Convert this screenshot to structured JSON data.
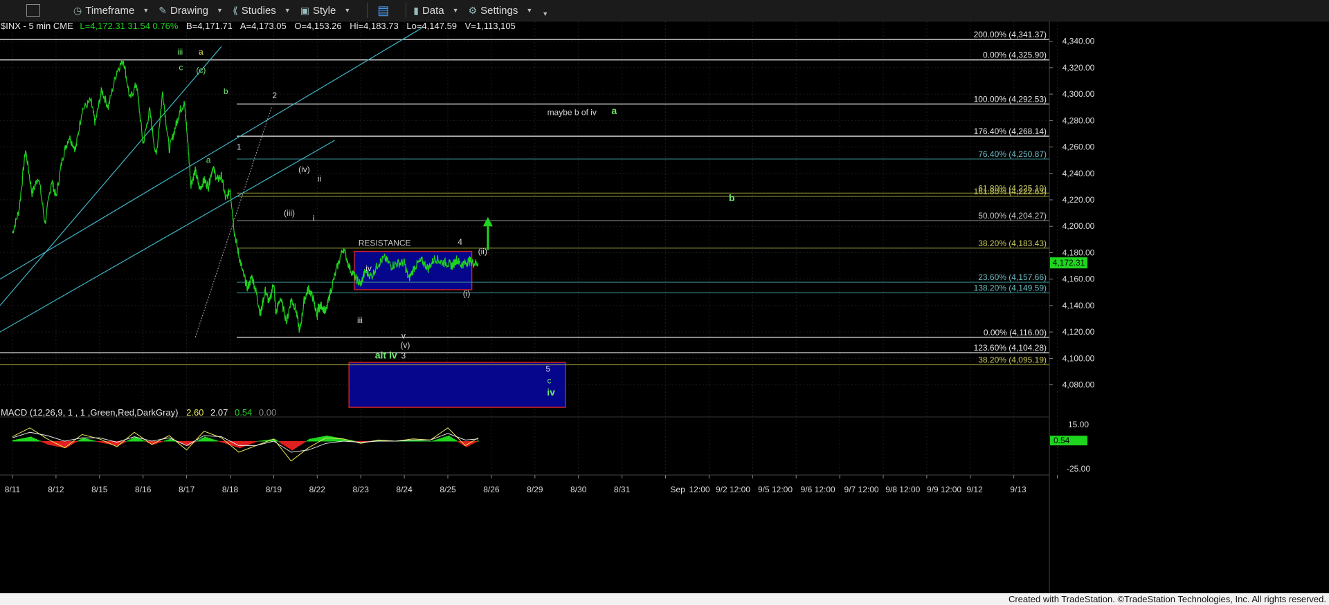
{
  "toolbar": {
    "timeframe_label": "Timeframe",
    "drawing_label": "Drawing",
    "studies_label": "Studies",
    "style_label": "Style",
    "data_label": "Data",
    "settings_label": "Settings"
  },
  "symbol_bar": {
    "symbol": "$INX - 5 min  CME",
    "last": "L=4,172.31  31.54  0.76%",
    "bid": "B=4,171.71",
    "ask": "A=4,173.05",
    "open": "O=4,153.26",
    "high": "Hi=4,183.73",
    "low": "Lo=4,147.59",
    "volume": "V=1,113,105"
  },
  "indicator": {
    "label": "MACD (12,26,9, 1 , 1 ,Green,Red,DarkGray)",
    "macd": "2.60",
    "signal": "2.07",
    "hist": "0.54",
    "zero": "0.00",
    "axis_labels": [
      "15.00",
      "0.54",
      "-25.00"
    ]
  },
  "footer_text": "Created with TradeStation. ©TradeStation Technologies, Inc. All rights reserved.",
  "colors": {
    "price": "#1fd41f",
    "channel": "#3fb6c8",
    "fib_white": "#dcdcdc",
    "fib_gray": "#9aa0a6",
    "fib_teal": "#3d8f94",
    "fib_olive": "#9a9a3a",
    "box_fill": "#06068c",
    "box_border": "#cc2222",
    "label_green": "#6fe86f",
    "label_yellow": "#e8e85a"
  },
  "chart_data": {
    "type": "line",
    "title": "",
    "ylim": [
      4062,
      4355
    ],
    "y_ticks": [
      4080,
      4100,
      4120,
      4140,
      4160,
      4180,
      4200,
      4220,
      4240,
      4260,
      4280,
      4300,
      4320,
      4340
    ],
    "y_tick_labels": [
      "4,080.00",
      "4,100.00",
      "4,120.00",
      "4,140.00",
      "4,160.00",
      "4,180.00",
      "4,200.00",
      "4,220.00",
      "4,240.00",
      "4,260.00",
      "4,280.00",
      "4,300.00",
      "4,320.00",
      "4,340.00"
    ],
    "last_price_label": "4,172.31",
    "last_price": 4172.31,
    "x_tick_labels": [
      "8/11",
      "8/12",
      "8/15",
      "8/16",
      "8/17",
      "8/18",
      "8/19",
      "8/22",
      "8/23",
      "8/24",
      "8/25",
      "8/26",
      "8/29",
      "8/30",
      "8/31",
      "Sep",
      "12:00",
      "9/2 12:00",
      "9/5 12:00",
      "9/6 12:00",
      "9/7 12:00",
      "9/8 12:00",
      "9/9 12:00",
      "9/12",
      "9/13"
    ],
    "series": [
      {
        "x": [
          0.0,
          0.15,
          0.3,
          0.45,
          0.6,
          0.75,
          0.9,
          1.0,
          1.15,
          1.3,
          1.45,
          1.6,
          1.8,
          1.9,
          2.05,
          2.2,
          2.4,
          2.55,
          2.7,
          2.85,
          3.0,
          3.15,
          3.3,
          3.45,
          3.6,
          3.75,
          3.85,
          3.95,
          4.0,
          4.1,
          4.2,
          4.3,
          4.4,
          4.5,
          4.6,
          4.7,
          4.8,
          4.9,
          5.0,
          5.1,
          5.2,
          5.3,
          5.4,
          5.5,
          5.6,
          5.7,
          5.8,
          5.9,
          6.0,
          6.05,
          6.15,
          6.3,
          6.4,
          6.5,
          6.6,
          6.7,
          6.8,
          6.9,
          7.0,
          7.02,
          7.1,
          7.2,
          7.3,
          7.45,
          7.6,
          7.75,
          7.9,
          8.0,
          8.1,
          8.25,
          8.4,
          8.55,
          8.7,
          8.85,
          9.0,
          9.1,
          9.25,
          9.4,
          9.55,
          9.7,
          9.85,
          10.0,
          10.1,
          10.2,
          10.3,
          10.4,
          10.5,
          10.6,
          10.7
        ],
        "y": [
          4195,
          4212,
          4258,
          4225,
          4238,
          4202,
          4235,
          4222,
          4252,
          4268,
          4258,
          4288,
          4295,
          4278,
          4303,
          4290,
          4318,
          4326,
          4296,
          4308,
          4262,
          4288,
          4252,
          4302,
          4258,
          4276,
          4288,
          4293,
          4275,
          4232,
          4242,
          4228,
          4235,
          4230,
          4245,
          4235,
          4238,
          4220,
          4229,
          4195,
          4178,
          4164,
          4153,
          4162,
          4150,
          4133,
          4152,
          4142,
          4158,
          4134,
          4146,
          4128,
          4145,
          4138,
          4120,
          4144,
          4153,
          4146,
          4132,
          4138,
          4140,
          4135,
          4150,
          4168,
          4184,
          4168,
          4160,
          4156,
          4166,
          4162,
          4172,
          4176,
          4170,
          4172,
          4172.31,
          4160,
          4170,
          4174,
          4168,
          4176,
          4173,
          4172,
          4170,
          4175,
          4171,
          4172,
          4174,
          4172,
          4172.31
        ]
      }
    ],
    "macd_series": {
      "x": [
        0,
        0.4,
        0.8,
        1.2,
        1.6,
        2,
        2.4,
        2.8,
        3.2,
        3.6,
        4,
        4.4,
        4.8,
        5.2,
        5.6,
        6,
        6.4,
        6.8,
        7.2,
        7.6,
        8,
        8.4,
        8.8,
        9.2,
        9.6,
        10,
        10.4,
        10.7
      ],
      "macd": [
        4,
        12,
        2,
        -6,
        6,
        2,
        -5,
        8,
        -3,
        5,
        -8,
        9,
        3,
        -10,
        -4,
        2,
        -18,
        -6,
        3,
        2,
        -2,
        1,
        0,
        2,
        1,
        12,
        -4,
        3
      ],
      "signal": [
        3,
        8,
        5,
        0,
        3,
        3,
        -1,
        4,
        0,
        3,
        -4,
        5,
        4,
        -4,
        -4,
        0,
        -10,
        -8,
        -2,
        0,
        -1,
        0,
        0,
        1,
        1,
        7,
        1,
        2
      ]
    },
    "fib_levels": [
      {
        "label": "200.00% (4,341.37)",
        "value": 4341.37,
        "tone": "white"
      },
      {
        "label": "0.00% (4,325.90)",
        "value": 4325.9,
        "tone": "white"
      },
      {
        "label": "100.00% (4,292.53)",
        "value": 4292.53,
        "tone": "white"
      },
      {
        "label": "176.40% (4,268.14)",
        "value": 4268.14,
        "tone": "white"
      },
      {
        "label": "76.40% (4,250.87)",
        "value": 4250.87,
        "tone": "teal"
      },
      {
        "label": "61.80% (4,225.10)",
        "value": 4225.1,
        "tone": "olive"
      },
      {
        "label": "161.80% (4,222.63)",
        "value": 4222.63,
        "tone": "olive"
      },
      {
        "label": "50.00% (4,204.27)",
        "value": 4204.27,
        "tone": "gray"
      },
      {
        "label": "38.20% (4,183.43)",
        "value": 4183.43,
        "tone": "olive"
      },
      {
        "label": "23.60% (4,157.66)",
        "value": 4157.66,
        "tone": "teal"
      },
      {
        "label": "138.20% (4,149.59)",
        "value": 4149.59,
        "tone": "teal"
      },
      {
        "label": "0.00% (4,116.00)",
        "value": 4116.0,
        "tone": "white"
      },
      {
        "label": "123.60% (4,104.28)",
        "value": 4104.28,
        "tone": "white"
      },
      {
        "label": "38.20% (4,095.19)",
        "value": 4095.19,
        "tone": "olive"
      }
    ],
    "boxes": [
      {
        "name": "resistance",
        "x0": 7.85,
        "x1": 10.55,
        "y0": 4152,
        "y1": 4181,
        "label": "RESISTANCE"
      },
      {
        "name": "target",
        "x0": 7.73,
        "x1": 12.7,
        "y0": 4063,
        "y1": 4097,
        "label": ""
      }
    ],
    "wave_labels": [
      {
        "text": "iii",
        "x": 3.85,
        "y": 4330,
        "color": "green"
      },
      {
        "text": "a",
        "x": 4.33,
        "y": 4330,
        "color": "yellow"
      },
      {
        "text": "c",
        "x": 3.87,
        "y": 4318,
        "color": "green"
      },
      {
        "text": "(c)",
        "x": 4.33,
        "y": 4316,
        "color": "green"
      },
      {
        "text": "b",
        "x": 4.9,
        "y": 4300,
        "color": "green"
      },
      {
        "text": "2",
        "x": 6.02,
        "y": 4297,
        "color": "white"
      },
      {
        "text": "1",
        "x": 5.2,
        "y": 4258,
        "color": "white"
      },
      {
        "text": "a",
        "x": 4.5,
        "y": 4248,
        "color": "green"
      },
      {
        "text": "(iv)",
        "x": 6.7,
        "y": 4241,
        "color": "white"
      },
      {
        "text": "ii",
        "x": 7.05,
        "y": 4234,
        "color": "white"
      },
      {
        "text": "(iii)",
        "x": 6.36,
        "y": 4208,
        "color": "white"
      },
      {
        "text": "i",
        "x": 6.92,
        "y": 4204,
        "color": "white"
      },
      {
        "text": "iv",
        "x": 8.18,
        "y": 4166,
        "color": "white"
      },
      {
        "text": "4",
        "x": 10.28,
        "y": 4186,
        "color": "white"
      },
      {
        "text": "(ii)",
        "x": 10.8,
        "y": 4179,
        "color": "white"
      },
      {
        "text": "(i)",
        "x": 10.43,
        "y": 4147,
        "color": "white"
      },
      {
        "text": "iii",
        "x": 7.98,
        "y": 4127,
        "color": "white"
      },
      {
        "text": "v",
        "x": 8.98,
        "y": 4115,
        "color": "white"
      },
      {
        "text": "(v)",
        "x": 9.02,
        "y": 4108,
        "color": "white"
      },
      {
        "text": "3",
        "x": 8.98,
        "y": 4100,
        "color": "white"
      },
      {
        "text": "alt iv",
        "x": 8.58,
        "y": 4100,
        "color": "green",
        "bold": true
      },
      {
        "text": "maybe b of iv",
        "x": 12.85,
        "y": 4284,
        "color": "white"
      },
      {
        "text": "a",
        "x": 13.82,
        "y": 4285,
        "color": "green",
        "bold": true
      },
      {
        "text": "b",
        "x": 16.52,
        "y": 4219,
        "color": "green",
        "bold": true
      },
      {
        "text": "5",
        "x": 12.3,
        "y": 4090,
        "color": "white"
      },
      {
        "text": "c",
        "x": 12.33,
        "y": 4081,
        "color": "green"
      },
      {
        "text": "iv",
        "x": 12.37,
        "y": 4072,
        "color": "green",
        "bold": true
      }
    ]
  }
}
